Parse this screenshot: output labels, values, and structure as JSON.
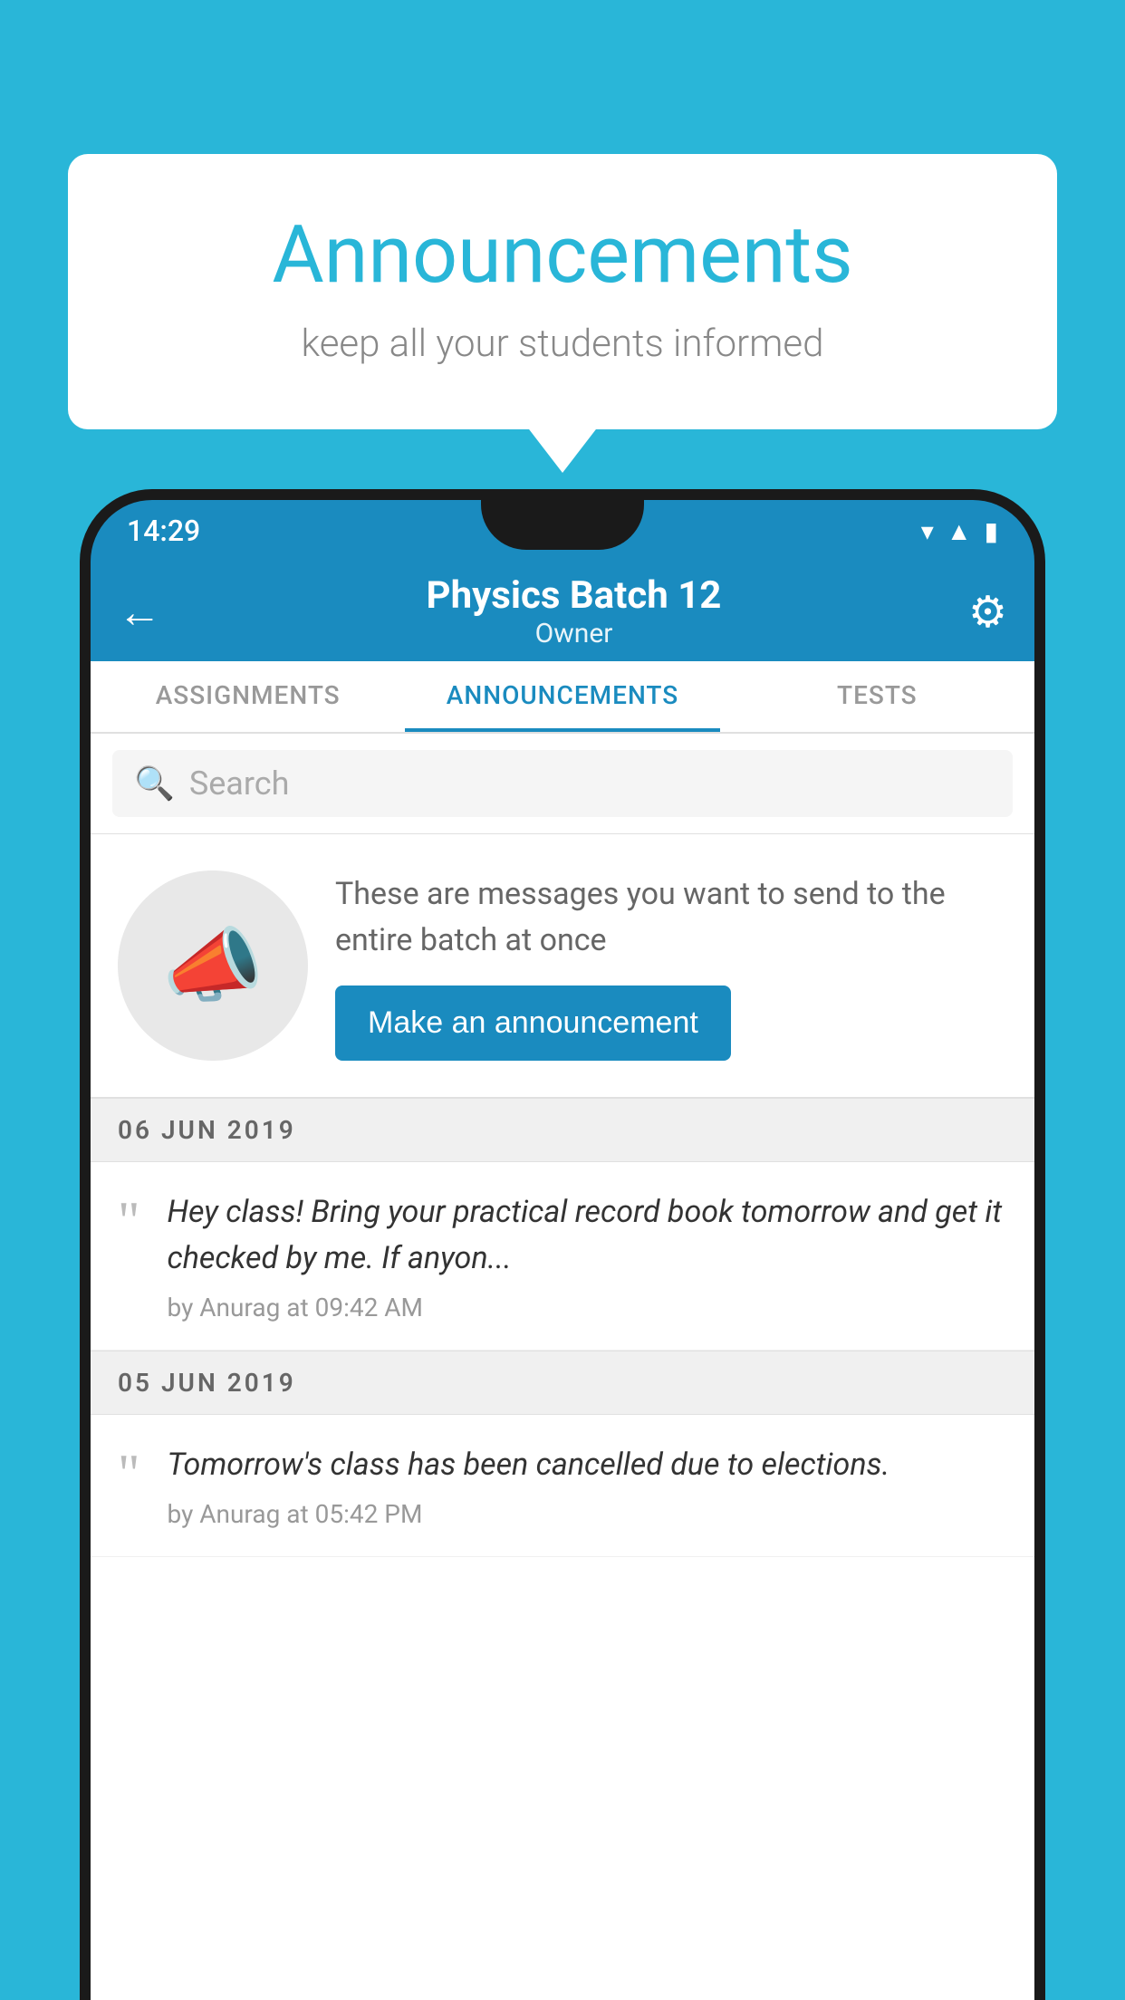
{
  "background_color": "#29b6d8",
  "speech_bubble": {
    "title": "Announcements",
    "subtitle": "keep all your students informed"
  },
  "phone": {
    "status_bar": {
      "time": "14:29",
      "icons": [
        "wifi",
        "signal",
        "battery"
      ]
    },
    "app_bar": {
      "title": "Physics Batch 12",
      "subtitle": "Owner",
      "back_label": "←",
      "settings_label": "⚙"
    },
    "tabs": [
      {
        "label": "ASSIGNMENTS",
        "active": false
      },
      {
        "label": "ANNOUNCEMENTS",
        "active": true
      },
      {
        "label": "TESTS",
        "active": false
      }
    ],
    "search": {
      "placeholder": "Search"
    },
    "promo": {
      "text": "These are messages you want to send to the entire batch at once",
      "button_label": "Make an announcement"
    },
    "announcements": [
      {
        "date": "06  JUN  2019",
        "text": "Hey class! Bring your practical record book tomorrow and get it checked by me. If anyon...",
        "meta": "by Anurag at 09:42 AM"
      },
      {
        "date": "05  JUN  2019",
        "text": "Tomorrow's class has been cancelled due to elections.",
        "meta": "by Anurag at 05:42 PM"
      }
    ]
  }
}
